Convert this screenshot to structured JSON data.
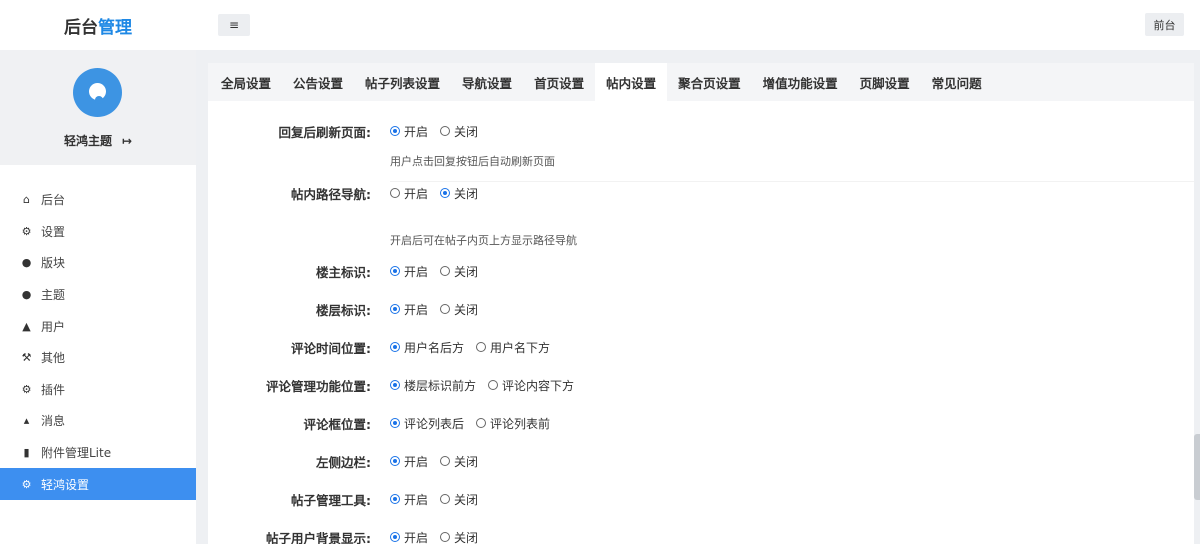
{
  "header": {
    "brand_prefix": "后台",
    "brand_accent": "管理",
    "menu_toggle": "≡",
    "front_button": "前台"
  },
  "sidebar": {
    "profile_name": "轻鸿主题",
    "items": [
      {
        "label": "后台",
        "icon": "home-icon"
      },
      {
        "label": "设置",
        "icon": "gear-icon"
      },
      {
        "label": "版块",
        "icon": "comment-icon"
      },
      {
        "label": "主题",
        "icon": "comment-icon"
      },
      {
        "label": "用户",
        "icon": "user-icon"
      },
      {
        "label": "其他",
        "icon": "wrench-icon"
      },
      {
        "label": "插件",
        "icon": "gears-icon"
      },
      {
        "label": "消息",
        "icon": "bell-icon"
      },
      {
        "label": "附件管理Lite",
        "icon": "file-icon"
      },
      {
        "label": "轻鸿设置",
        "icon": "gear-icon",
        "active": true
      }
    ]
  },
  "tabs": [
    "全局设置",
    "公告设置",
    "帖子列表设置",
    "导航设置",
    "首页设置",
    "帖内设置",
    "聚合页设置",
    "增值功能设置",
    "页脚设置",
    "常见问题"
  ],
  "active_tab": "帖内设置",
  "settings": [
    {
      "label": "回复后刷新页面:",
      "options": [
        "开启",
        "关闭"
      ],
      "selected": "开启",
      "hint": "用户点击回复按钮后自动刷新页面"
    },
    {
      "label": "帖内路径导航:",
      "options": [
        "开启",
        "关闭"
      ],
      "selected": "关闭",
      "hint": "开启后可在帖子内页上方显示路径导航"
    },
    {
      "label": "楼主标识:",
      "options": [
        "开启",
        "关闭"
      ],
      "selected": "开启"
    },
    {
      "label": "楼层标识:",
      "options": [
        "开启",
        "关闭"
      ],
      "selected": "开启"
    },
    {
      "label": "评论时间位置:",
      "options": [
        "用户名后方",
        "用户名下方"
      ],
      "selected": "用户名后方"
    },
    {
      "label": "评论管理功能位置:",
      "options": [
        "楼层标识前方",
        "评论内容下方"
      ],
      "selected": "楼层标识前方"
    },
    {
      "label": "评论框位置:",
      "options": [
        "评论列表后",
        "评论列表前"
      ],
      "selected": "评论列表后"
    },
    {
      "label": "左侧边栏:",
      "options": [
        "开启",
        "关闭"
      ],
      "selected": "开启"
    },
    {
      "label": "帖子管理工具:",
      "options": [
        "开启",
        "关闭"
      ],
      "selected": "开启"
    },
    {
      "label": "帖子用户背景显示:",
      "options": [
        "开启",
        "关闭"
      ],
      "selected": "开启"
    }
  ],
  "colors": {
    "accent": "#3d8ff0",
    "brand_accent": "#1e88e5",
    "radio_on": "#1a73e8"
  }
}
